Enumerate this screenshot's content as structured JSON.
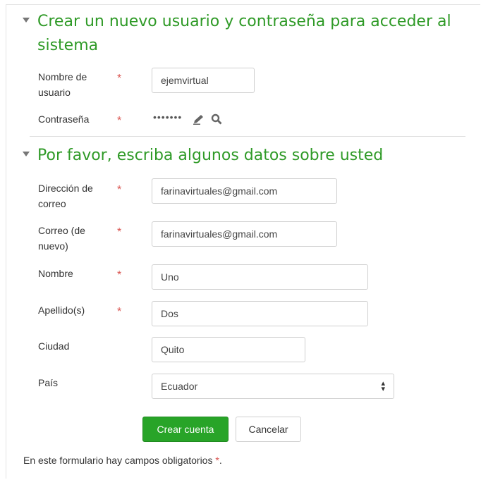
{
  "section1": {
    "title": "Crear un nuevo usuario y contraseña para acceder al sistema",
    "username": {
      "label": "Nombre de usuario",
      "value": "ejemvirtual"
    },
    "password": {
      "label": "Contraseña",
      "masked_value": "•••••••",
      "edit_icon": "pencil-icon",
      "reveal_icon": "search-icon"
    }
  },
  "section2": {
    "title": "Por favor, escriba algunos datos sobre usted",
    "email": {
      "label": "Dirección de correo",
      "value": "farinavirtuales@gmail.com"
    },
    "email_confirm": {
      "label": "Correo (de nuevo)",
      "value": "farinavirtuales@gmail.com"
    },
    "firstname": {
      "label": "Nombre",
      "value": "Uno"
    },
    "lastname": {
      "label": "Apellido(s)",
      "value": "Dos"
    },
    "city": {
      "label": "Ciudad",
      "value": "Quito"
    },
    "country": {
      "label": "País",
      "value": "Ecuador"
    }
  },
  "required_marker": "*",
  "buttons": {
    "create": "Crear cuenta",
    "cancel": "Cancelar"
  },
  "footer": {
    "note": "En este formulario hay campos obligatorios",
    "star": "*",
    "period": "."
  },
  "colors": {
    "accent": "#2f9a27",
    "required": "#d9534f",
    "button": "#28a428"
  }
}
